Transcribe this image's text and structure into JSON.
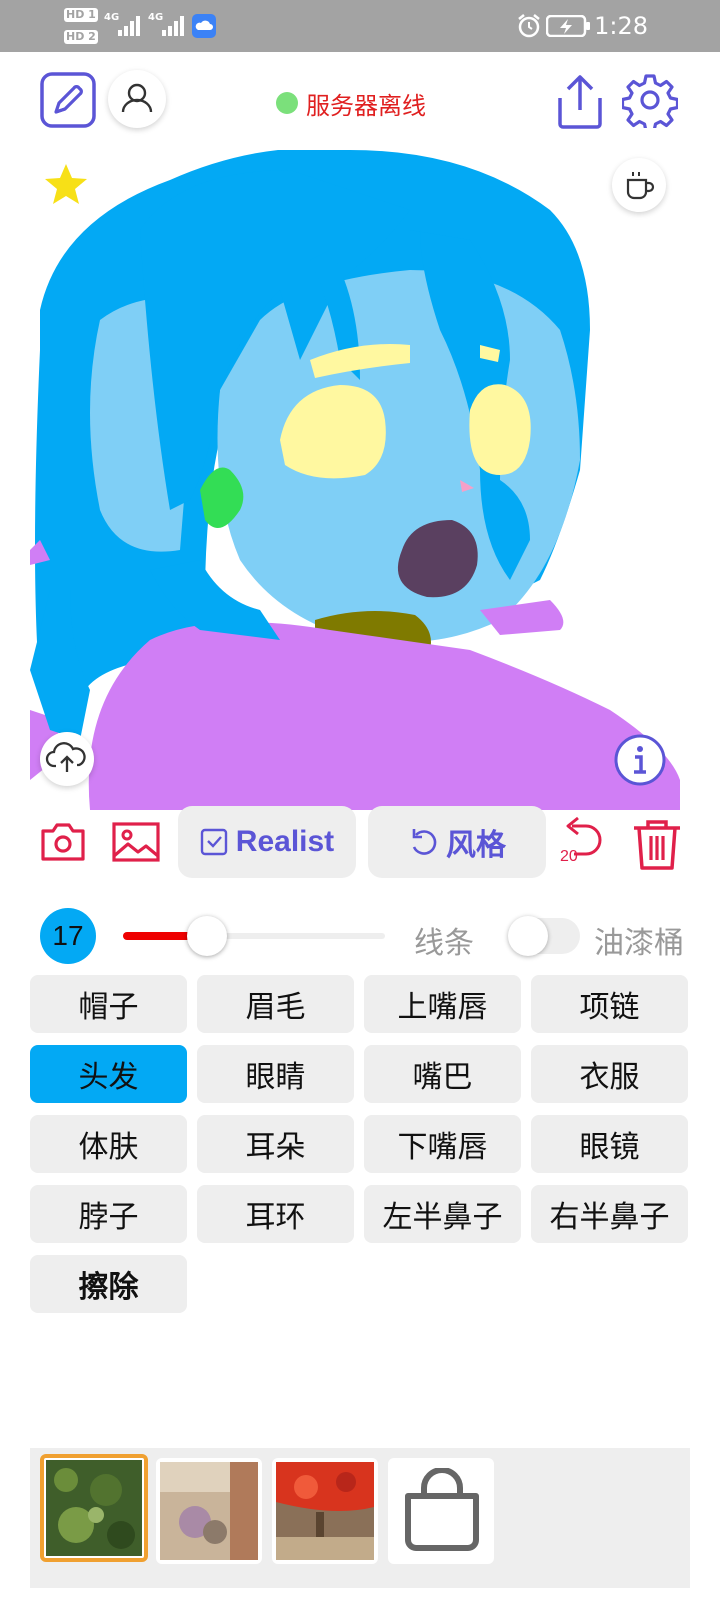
{
  "status_bar": {
    "hd1": "HD 1",
    "hd2": "HD 2",
    "net1": "4G",
    "net2": "4G",
    "time": "1:28"
  },
  "header": {
    "server_status": "服务器离线",
    "server_status_color": "#e02020",
    "online_dot_color": "#7be07b"
  },
  "toolbar": {
    "realist_label": "Realist",
    "style_label": "风格",
    "undo_count": "20"
  },
  "brush": {
    "size": "17",
    "size_fraction": 0.32,
    "line_label": "线条",
    "bucket_label": "油漆桶",
    "bucket_on": false
  },
  "parts": [
    {
      "label": "帽子"
    },
    {
      "label": "眉毛"
    },
    {
      "label": "上嘴唇"
    },
    {
      "label": "项链"
    },
    {
      "label": "头发",
      "selected": true
    },
    {
      "label": "眼睛"
    },
    {
      "label": "嘴巴"
    },
    {
      "label": "衣服"
    },
    {
      "label": "体肤"
    },
    {
      "label": "耳朵"
    },
    {
      "label": "下嘴唇"
    },
    {
      "label": "眼镜"
    },
    {
      "label": "脖子"
    },
    {
      "label": "耳环"
    },
    {
      "label": "左半鼻子"
    },
    {
      "label": "右半鼻子"
    },
    {
      "label": "擦除",
      "bold": true
    }
  ],
  "palette": {
    "items": [
      "texture-green",
      "texture-beige",
      "texture-red",
      "bag-icon"
    ],
    "selected_index": 0
  },
  "colors": {
    "accent": "#5b55d6",
    "red": "#e0204a",
    "selected": "#03a9f4",
    "hair": "#03a9f4",
    "skin": "#7fcff6",
    "clothes": "#d07ef5"
  }
}
